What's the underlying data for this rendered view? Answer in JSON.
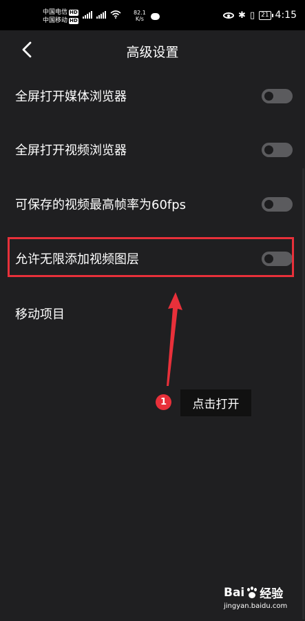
{
  "status_bar": {
    "carrier_1": "中国电信",
    "carrier_2": "中国移动",
    "hd": "HD",
    "net": "4G",
    "speed_value": "82.1",
    "speed_unit": "K/s",
    "battery": "21",
    "time": "4:15"
  },
  "header": {
    "title": "高级设置"
  },
  "settings": [
    {
      "label": "全屏打开媒体浏览器",
      "enabled": false
    },
    {
      "label": "全屏打开视频浏览器",
      "enabled": false
    },
    {
      "label": "可保存的视频最高帧率为60fps",
      "enabled": false
    },
    {
      "label": "允许无限添加视频图层",
      "enabled": false
    },
    {
      "label": "移动项目"
    }
  ],
  "annotation": {
    "step_number": "1",
    "tooltip": "点击打开",
    "highlight_color": "#e8303a"
  },
  "watermark": {
    "brand": "Bai",
    "brand_suffix": "经验",
    "url": "jingyan.baidu.com"
  },
  "colors": {
    "background": "#1f1f21",
    "toggle_off": "#5b5b5e",
    "accent_red": "#e8303a"
  }
}
